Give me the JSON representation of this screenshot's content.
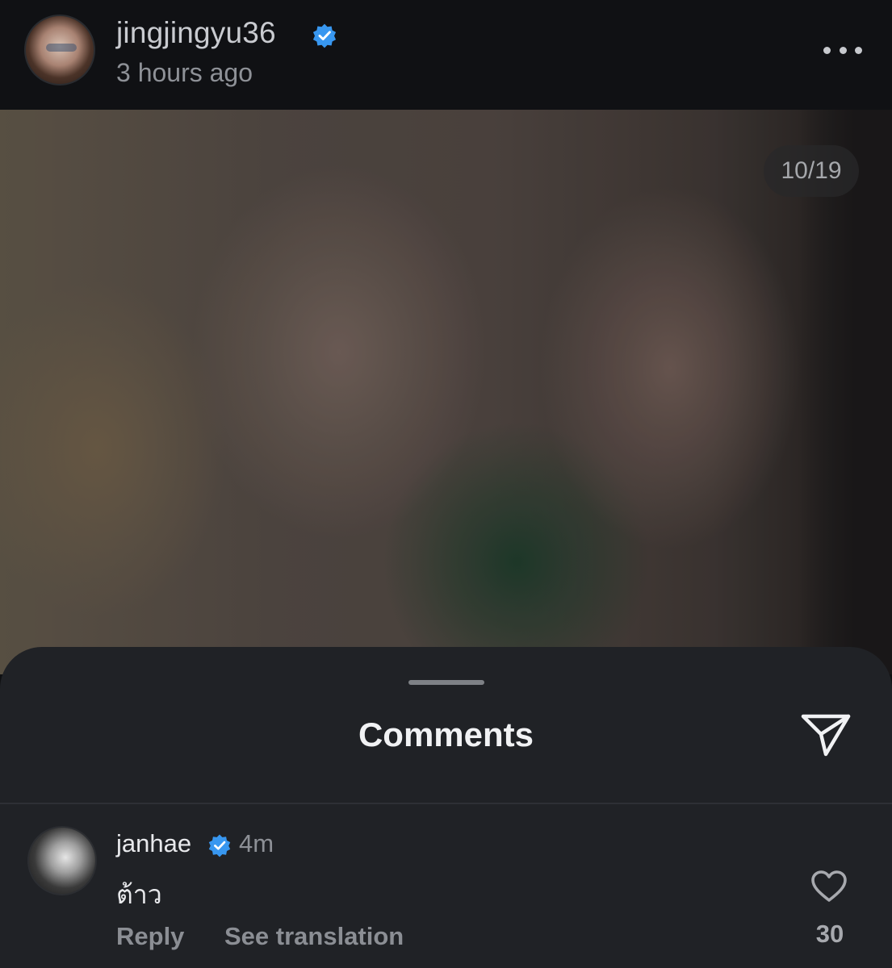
{
  "header": {
    "username": "jingjingyu36",
    "time_ago": "3 hours ago",
    "verified_color": "#3897f0"
  },
  "photo": {
    "counter": "10/19"
  },
  "comments_sheet": {
    "title": "Comments"
  },
  "comment": {
    "username": "janhae",
    "time": "4m",
    "text": "ต้าว",
    "reply_label": "Reply",
    "translation_label": "See translation",
    "like_count": "30"
  }
}
